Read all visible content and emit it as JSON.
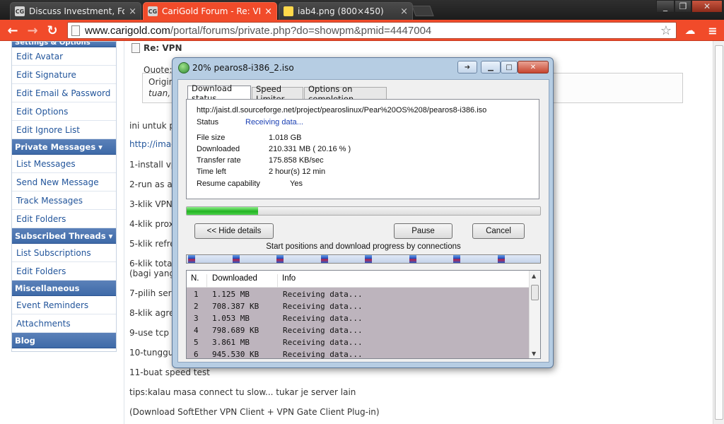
{
  "browser": {
    "tabs": [
      {
        "label": "Discuss Investment, Forex",
        "favicon": "CG"
      },
      {
        "label": "CariGold Forum - Re: VPN",
        "favicon": "CG"
      },
      {
        "label": "iab4.png (800×450)",
        "favicon": "image-icon"
      }
    ],
    "url_domain": "www.carigold.com",
    "url_path": "/portal/forums/private.php?do=showpm&pmid=4447004"
  },
  "sidebar": {
    "partial_header": "Settings & Options",
    "settings_items": [
      "Edit Avatar",
      "Edit Signature",
      "Edit Email & Password",
      "Edit Options",
      "Edit Ignore List"
    ],
    "pm_header": "Private Messages ▾",
    "pm_items": [
      "List Messages",
      "Send New Message",
      "Track Messages",
      "Edit Folders"
    ],
    "sub_header": "Subscribed Threads ▾",
    "sub_items": [
      "List Subscriptions",
      "Edit Folders"
    ],
    "misc_header": "Miscellaneous",
    "misc_items": [
      "Event Reminders",
      "Attachments"
    ],
    "blog_header": "Blog"
  },
  "post": {
    "title": "Re: VPN",
    "quote_label": "Quote:",
    "quote_line1": "Origina",
    "quote_line2": "tuan,",
    "lines": [
      "ini untuk pe",
      "http://imag",
      "1-install vpn",
      "2-run as ad",
      "3-klik VPN G",
      "4-klik proxy",
      "5-klik refres",
      "6-klik total",
      "(bagi yang",
      "7-pilih serve",
      "8-klik agree",
      "9-use tcp p",
      "10-tunggu",
      "11-buat speed test",
      "tips:kalau masa connect tu slow... tukar je server lain",
      "(Download SoftEther VPN Client + VPN Gate Client Plug-in)"
    ]
  },
  "dialog": {
    "title": "20% pearos8-i386_2.iso",
    "tabs": [
      "Download status",
      "Speed Limiter",
      "Options on completion"
    ],
    "url": "http://jaist.dl.sourceforge.net/project/pearoslinux/Pear%20OS%208/pearos8-i386.iso",
    "status_label": "Status",
    "status_value": "Receiving data...",
    "details": [
      {
        "label": "File size",
        "value": "1.018  GB"
      },
      {
        "label": "Downloaded",
        "value": "210.331  MB  ( 20.16 % )"
      },
      {
        "label": "Transfer rate",
        "value": "175.858  KB/sec"
      },
      {
        "label": "Time left",
        "value": "2 hour(s) 12 min"
      }
    ],
    "resume_label": "Resume capability",
    "resume_value": "Yes",
    "progress_fraction": 0.2016,
    "hide_details_label": "<< Hide details",
    "pause_label": "Pause",
    "cancel_label": "Cancel",
    "connections_label": "Start positions and download progress by connections",
    "connection_count": 8,
    "table_headers": [
      "N.",
      "Downloaded",
      "Info"
    ],
    "connections": [
      {
        "n": "1",
        "downloaded": "1.125 MB",
        "info": "Receiving data..."
      },
      {
        "n": "2",
        "downloaded": "708.387 KB",
        "info": "Receiving data..."
      },
      {
        "n": "3",
        "downloaded": "1.053 MB",
        "info": "Receiving data..."
      },
      {
        "n": "4",
        "downloaded": "798.689 KB",
        "info": "Receiving data..."
      },
      {
        "n": "5",
        "downloaded": "3.861 MB",
        "info": "Receiving data..."
      },
      {
        "n": "6",
        "downloaded": "945.530 KB",
        "info": "Receiving data..."
      }
    ]
  },
  "colors": {
    "browser_accent": "#f14b2a",
    "sidebar_header": "#4a74ae",
    "link": "#22559b"
  }
}
